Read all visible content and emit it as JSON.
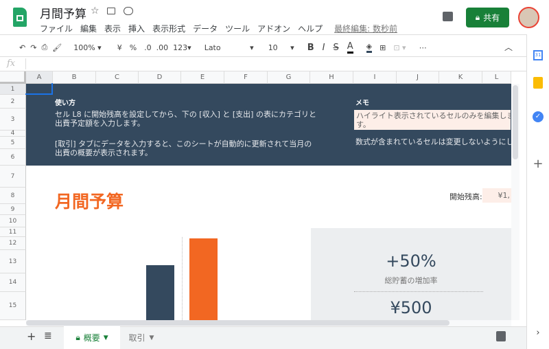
{
  "app": {
    "title": "月間予算",
    "last_edit": "最終編集: 数秒前",
    "share": "共有"
  },
  "menu": [
    "ファイル",
    "編集",
    "表示",
    "挿入",
    "表示形式",
    "データ",
    "ツール",
    "アドオン",
    "ヘルプ"
  ],
  "toolbar": {
    "zoom": "100%",
    "currency": "¥",
    "percent": "%",
    "dec_less": ".0",
    "dec_more": ".00",
    "format": "123",
    "font": "Lato",
    "size": "10",
    "bold": "B",
    "italic": "I",
    "strike": "S",
    "textcolor": "A",
    "more": "⋯"
  },
  "formula": {
    "fx": "fx",
    "value": ""
  },
  "columns": [
    "A",
    "B",
    "C",
    "D",
    "E",
    "F",
    "G",
    "H",
    "I",
    "J",
    "K",
    "L"
  ],
  "rows": [
    "1",
    "2",
    "3",
    "4",
    "5",
    "6",
    "7",
    "8",
    "9",
    "10",
    "11",
    "12",
    "13",
    "14",
    "15"
  ],
  "banner": {
    "howto_title": "使い方",
    "howto_1a": "セル L8 に開始残高を設定してから、下の [収入] と [支出] の表にカテゴリと",
    "howto_1b": "出費予定額を入力します。",
    "howto_2a": "[取引] タブにデータを入力すると、このシートが自動的に更新されて当月の",
    "howto_2b": "出費の概要が表示されます。",
    "memo_title": "メモ",
    "memo_1a": "ハイライト表示されているセルのみを編集しま",
    "memo_1b": "す。",
    "memo_2": "数式が含まれているセルは変更しないようにし"
  },
  "sheet": {
    "title": "月間予算",
    "start_balance_label": "開始残高:",
    "start_balance_value": "¥1,",
    "stat1_value": "+50%",
    "stat1_label": "総貯蓄の増加率",
    "stat2_value": "¥500"
  },
  "tabs": [
    {
      "label": "概要",
      "active": true
    },
    {
      "label": "取引",
      "active": false
    }
  ],
  "colors": {
    "navy": "#34495e",
    "orange": "#f26722",
    "green": "#188038",
    "gray_panel": "#eceef0"
  }
}
